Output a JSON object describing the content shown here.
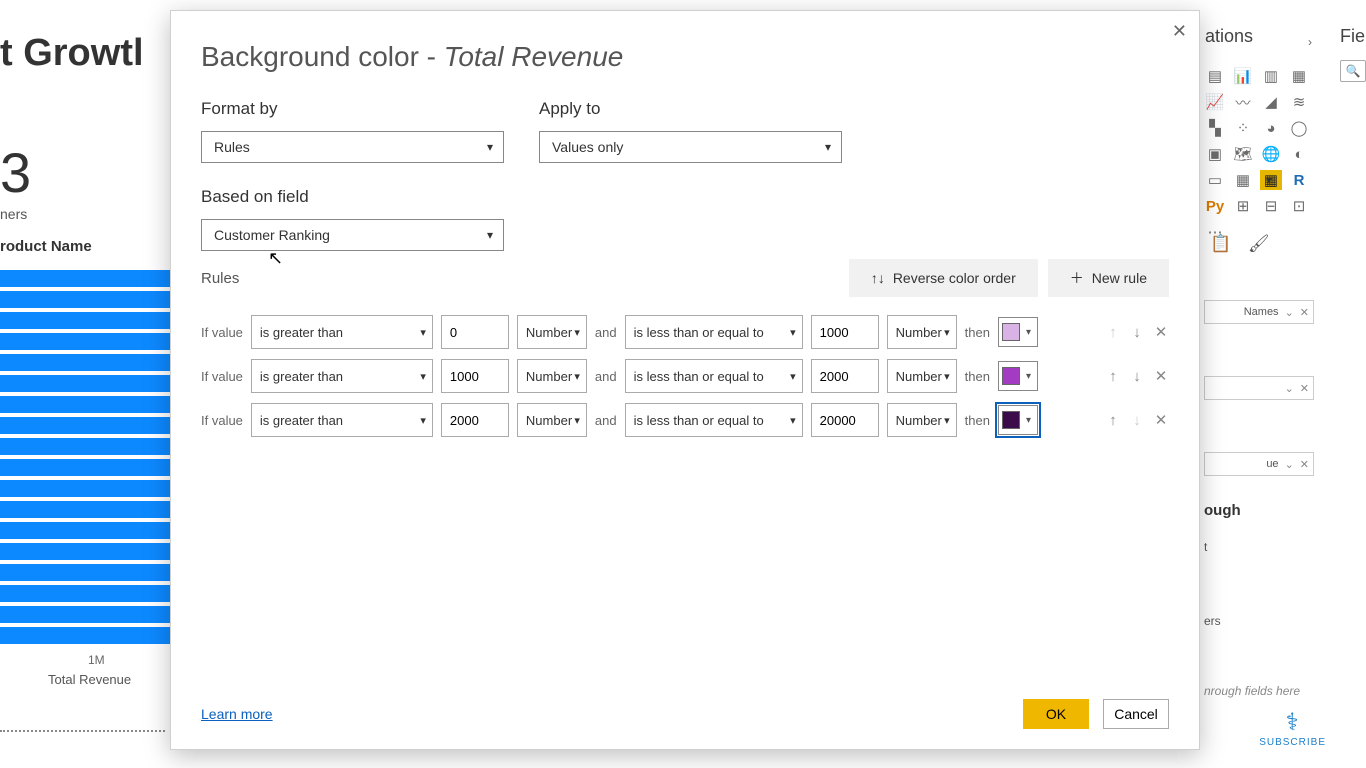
{
  "background": {
    "title_partial": "t Growtl",
    "big_number": "3",
    "sub": "ners",
    "col_header": "roduct Name",
    "axis_tick": "1M",
    "axis_label": "Total Revenue"
  },
  "panes": {
    "visualizations": "ations",
    "fields": "Fie",
    "search_glyph": "🔍",
    "field_rows": {
      "names": "Names",
      "revenue": "ue",
      "through_title": "ough",
      "through_sub1": "t",
      "through_sub2": "ers",
      "through_hint": "nrough fields here"
    }
  },
  "dialog": {
    "title_prefix": "Background color - ",
    "title_italic": "Total Revenue",
    "format_by_label": "Format by",
    "format_by_value": "Rules",
    "apply_to_label": "Apply to",
    "apply_to_value": "Values only",
    "based_on_label": "Based on field",
    "based_on_value": "Customer Ranking",
    "rules_label": "Rules",
    "reverse_label": "Reverse color order",
    "reverse_icon": "↑↓",
    "newrule_label": "New rule",
    "newrule_icon": "＋",
    "if_value": "If value",
    "and": "and",
    "then": "then",
    "learn_more": "Learn more",
    "ok": "OK",
    "cancel": "Cancel",
    "rules": [
      {
        "op1": "is greater than",
        "v1": "0",
        "t1": "Number",
        "op2": "is less than or equal to",
        "v2": "1000",
        "t2": "Number",
        "color": "#d9b3e6",
        "up_dis": true,
        "dn_dis": false
      },
      {
        "op1": "is greater than",
        "v1": "1000",
        "t1": "Number",
        "op2": "is less than or equal to",
        "v2": "2000",
        "t2": "Number",
        "color": "#a33cc2",
        "up_dis": false,
        "dn_dis": false
      },
      {
        "op1": "is greater than",
        "v1": "2000",
        "t1": "Number",
        "op2": "is less than or equal to",
        "v2": "20000",
        "t2": "Number",
        "color": "#3b0b4a",
        "up_dis": false,
        "dn_dis": true,
        "selected": true
      }
    ]
  },
  "subscribe": "SUBSCRIBE"
}
